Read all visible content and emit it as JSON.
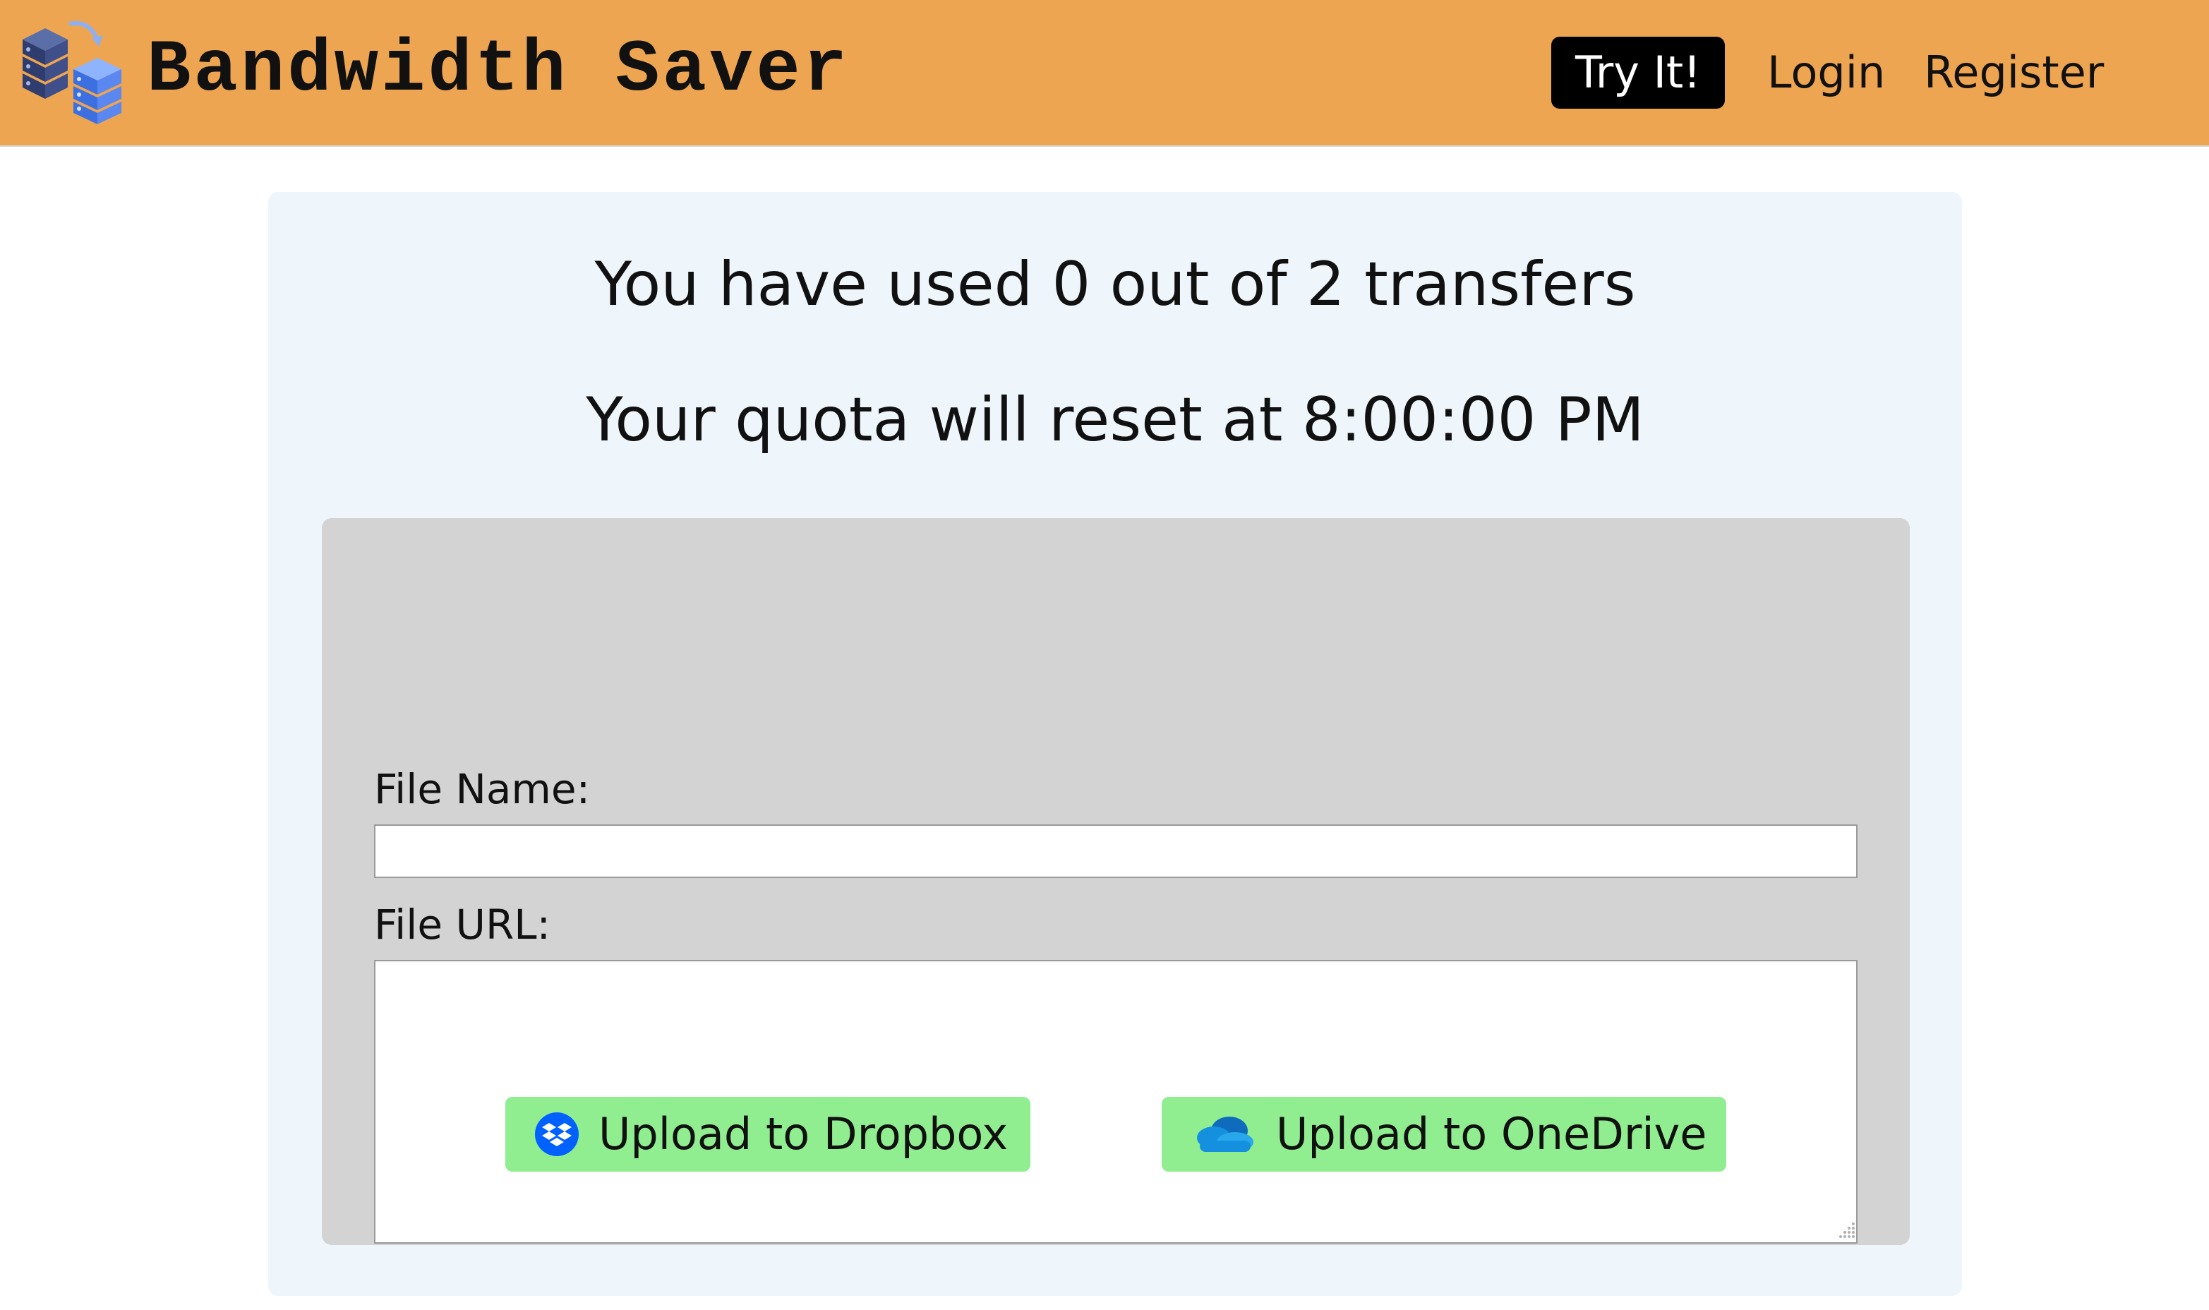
{
  "header": {
    "title": "Bandwidth Saver",
    "logo_icon": "server-stack-icon",
    "nav": {
      "try_it": "Try It!",
      "login": "Login",
      "register": "Register"
    }
  },
  "quota": {
    "used_text": "You have used 0 out of 2 transfers",
    "reset_text": "Your quota will reset at 8:00:00 PM"
  },
  "form": {
    "file_name_label": "File Name:",
    "file_name_value": "",
    "file_url_label": "File URL:",
    "file_url_value": ""
  },
  "buttons": {
    "dropbox_label": "Upload to Dropbox",
    "dropbox_icon": "dropbox-icon",
    "onedrive_label": "Upload to OneDrive",
    "onedrive_icon": "onedrive-icon"
  },
  "colors": {
    "header_bg": "#eea551",
    "panel_bg": "#eef6fc",
    "form_bg": "#d3d3d3",
    "button_bg": "#90ee90",
    "dropbox_blue": "#0061fe",
    "onedrive_blue": "#0f6cbd"
  }
}
